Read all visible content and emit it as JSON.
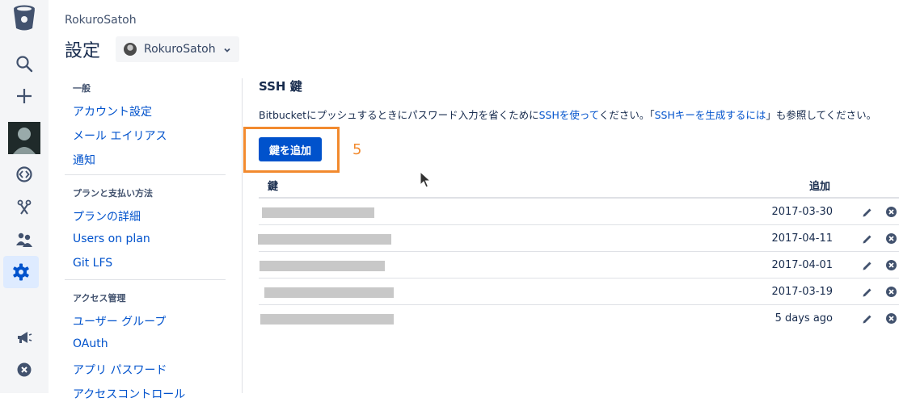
{
  "header": {
    "breadcrumb": "RokuroSatoh",
    "title": "設定",
    "account_select": {
      "selected": "RokuroSatoh"
    }
  },
  "global_nav": {
    "items": [
      {
        "icon": "bitbucket-logo-icon"
      },
      {
        "icon": "search-icon"
      },
      {
        "icon": "plus-icon"
      },
      {
        "icon": "avatar-icon"
      },
      {
        "icon": "repository-icon"
      },
      {
        "icon": "pull-requests-icon"
      },
      {
        "icon": "team-icon"
      },
      {
        "icon": "gear-icon"
      },
      {
        "icon": "megaphone-icon"
      },
      {
        "icon": "close-circle-icon"
      }
    ]
  },
  "sidebar": {
    "general": {
      "heading": "一般",
      "items": [
        "アカウント設定",
        "メール エイリアス",
        "通知"
      ]
    },
    "billing": {
      "heading": "プランと支払い方法",
      "items": [
        "プランの詳細",
        "Users on plan",
        "Git LFS"
      ]
    },
    "access": {
      "heading": "アクセス管理",
      "items": [
        "ユーザー グループ",
        "OAuth",
        "アプリ パスワード",
        "アクセスコントロール"
      ]
    }
  },
  "main": {
    "title": "SSH 鍵",
    "description": {
      "part1": "Bitbucketにプッシュするときにパスワード入力を省くために",
      "link1": "SSHを使って",
      "part2": "ください。「",
      "link2": "SSHキーを生成するには",
      "part3": "」も参照してください。"
    },
    "add_button": "鍵を追加",
    "step_label": "5",
    "table": {
      "headers": {
        "key": "鍵",
        "added": "追加"
      },
      "rows": [
        {
          "added": "2017-03-30"
        },
        {
          "added": "2017-04-11"
        },
        {
          "added": "2017-04-01"
        },
        {
          "added": "2017-03-19"
        },
        {
          "added": "5 days ago"
        }
      ]
    }
  },
  "colors": {
    "link": "#0052cc",
    "primary_button": "#0052cc",
    "highlight": "#f28a2e"
  }
}
